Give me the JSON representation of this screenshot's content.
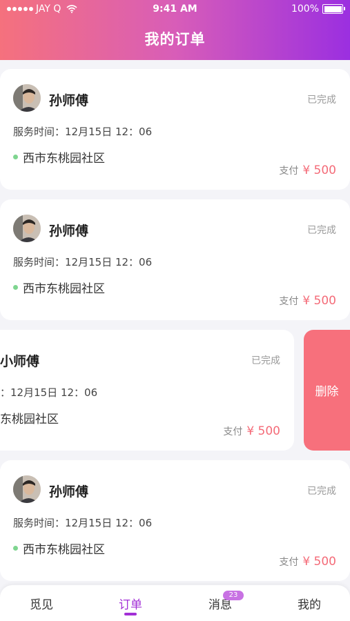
{
  "status_bar": {
    "carrier": "JAY Q",
    "time": "9:41 AM",
    "battery_percent_text": "100%",
    "battery_level": 1.0
  },
  "header": {
    "title": "我的订单",
    "gradient_colors": [
      "#f5717d",
      "#d85db8",
      "#9b2fe0"
    ]
  },
  "orders": [
    {
      "name": "孙师傅",
      "status": "已完成",
      "time_label": "服务时间：",
      "time": "12月15日 12：06",
      "address": "西市东桃园社区",
      "pay_label": "支付",
      "amount": "¥ 500"
    },
    {
      "name": "孙师傅",
      "status": "已完成",
      "time_label": "服务时间：",
      "time": "12月15日 12：06",
      "address": "西市东桃园社区",
      "pay_label": "支付",
      "amount": "¥ 500"
    },
    {
      "name": "孙师傅",
      "status": "已完成",
      "time_label": "：",
      "time": "12月15日 12：06",
      "address": "东桃园社区",
      "pay_label": "支付",
      "amount": "¥ 500",
      "swiped": true
    },
    {
      "name": "孙师傅",
      "status": "已完成",
      "time_label": "服务时间：",
      "time": "12月15日 12：06",
      "address": "西市东桃园社区",
      "pay_label": "支付",
      "amount": "¥ 500"
    }
  ],
  "swiped_card_name": "小师傅",
  "delete_label": "删除",
  "tabs": [
    {
      "label": "觅见",
      "active": false
    },
    {
      "label": "订单",
      "active": true
    },
    {
      "label": "消息",
      "active": false,
      "badge": "23"
    },
    {
      "label": "我的",
      "active": false
    }
  ],
  "colors": {
    "accent": "#a22fd6",
    "price": "#f46b78",
    "delete": "#f7707c",
    "address_dot": "#7ed58f"
  }
}
